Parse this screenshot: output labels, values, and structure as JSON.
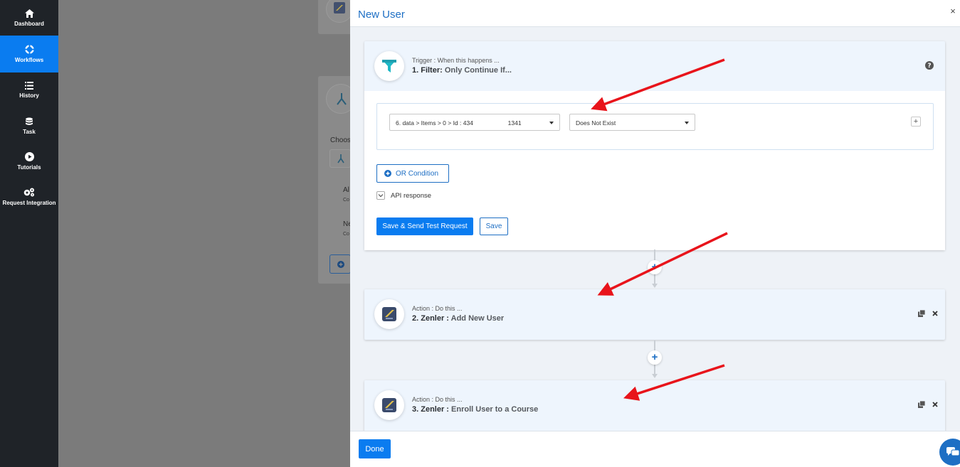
{
  "sidebar": {
    "items": [
      {
        "label": "Dashboard",
        "icon": "home-icon",
        "active": false
      },
      {
        "label": "Workflows",
        "icon": "workflows-icon",
        "active": true
      },
      {
        "label": "History",
        "icon": "history-icon",
        "active": false
      },
      {
        "label": "Task",
        "icon": "task-icon",
        "active": false
      },
      {
        "label": "Tutorials",
        "icon": "play-icon",
        "active": false
      },
      {
        "label": "Request Integration",
        "icon": "gears-icon",
        "active": false
      }
    ]
  },
  "background": {
    "choose_label": "Choos",
    "item1_title": "Al",
    "item1_sub": "Co",
    "item2_title": "Ne",
    "item2_sub": "Co"
  },
  "modal": {
    "title": "New User",
    "close_icon": "×",
    "steps": [
      {
        "kind": "Trigger : When this happens ...",
        "number_app": "1. Filter:",
        "event": "Only Continue If...",
        "icon": "filter-icon"
      },
      {
        "kind": "Action : Do this ...",
        "number_app": "2. Zenler :",
        "event": "Add New User",
        "icon": "zenler-icon"
      },
      {
        "kind": "Action : Do this ...",
        "number_app": "3. Zenler :",
        "event": "Enroll User to a Course",
        "icon": "zenler-icon"
      }
    ],
    "filter": {
      "field_prefix": "6. data > Items > 0 > Id : 434",
      "field_suffix": "1341",
      "operator": "Does Not Exist",
      "add_condition": "+",
      "or_condition": "OR Condition",
      "api_response": "API response",
      "save_send": "Save & Send Test Request",
      "save": "Save"
    },
    "footer": {
      "done": "Done"
    }
  },
  "colors": {
    "accent": "#0a7cf0",
    "sidebar_bg": "#1f2328",
    "annotation_arrow": "#e8141b"
  }
}
